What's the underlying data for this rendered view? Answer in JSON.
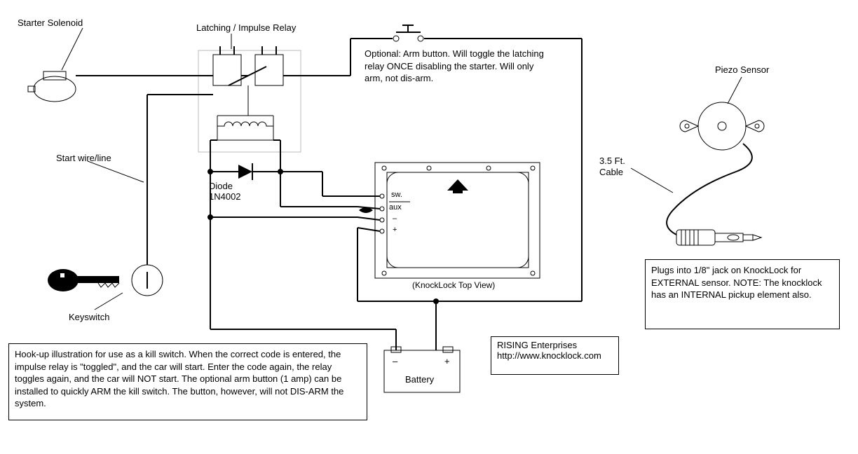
{
  "labels": {
    "starter_solenoid": "Starter Solenoid",
    "latching_relay": "Latching / Impulse Relay",
    "start_wire": "Start wire/line",
    "diode": "Diode",
    "diode_part": "1N4002",
    "keyswitch": "Keyswitch",
    "piezo_sensor": "Piezo Sensor",
    "cable_len": "3.5 Ft.",
    "cable_word": "Cable",
    "knocklock_caption": "(KnockLock Top View)",
    "battery": "Battery",
    "batt_neg": "–",
    "batt_pos": "+",
    "kterm_sw": "sw.",
    "kterm_aux": "aux",
    "kterm_neg": "–",
    "kterm_pos": "+"
  },
  "text": {
    "arm_button": "Optional:  Arm button.  Will toggle the latching relay ONCE disabling the starter.  Will only arm, not dis-arm.",
    "hookup": "Hook-up illustration for use as a kill switch.  When the correct code is entered, the impulse relay is \"toggled\", and the car will start.  Enter the code again, the relay toggles again, and the car will NOT start.  The optional arm button (1 amp) can be installed to quickly ARM the kill switch.  The button, however, will not DIS-ARM the system.",
    "company1": "RISING Enterprises",
    "company2": "http://www.knocklock.com",
    "piezo_note": "Plugs into 1/8\" jack on KnockLock for EXTERNAL sensor.  NOTE: The knocklock has an INTERNAL pickup element also."
  }
}
